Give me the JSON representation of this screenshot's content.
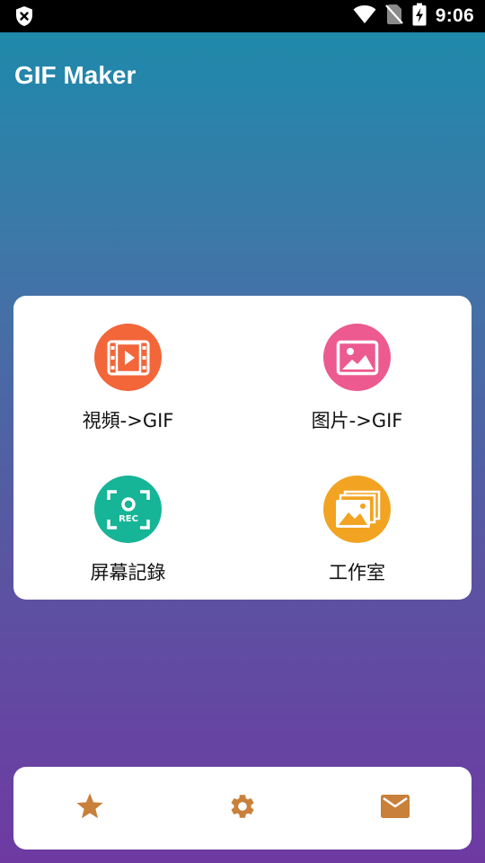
{
  "status_bar": {
    "time": "9:06",
    "icons": [
      "shield-x-icon",
      "wifi-icon",
      "no-sim-icon",
      "battery-charging-icon"
    ]
  },
  "app": {
    "title": "GIF Maker"
  },
  "menu": {
    "items": [
      {
        "label": "視頻->GIF",
        "icon": "video-film-icon",
        "color": "#f2663a"
      },
      {
        "label": "图片->GIF",
        "icon": "image-icon",
        "color": "#ec5a8f"
      },
      {
        "label": "屏幕記錄",
        "icon": "screen-record-icon",
        "color": "#16b597"
      },
      {
        "label": "工作室",
        "icon": "gallery-stack-icon",
        "color": "#f2a322"
      }
    ]
  },
  "bottom_bar": {
    "items": [
      {
        "icon": "star-icon"
      },
      {
        "icon": "gear-icon"
      },
      {
        "icon": "mail-icon"
      }
    ],
    "icon_color": "#c8803a"
  },
  "theme": {
    "gradient_top": "#1a8cab",
    "gradient_bottom": "#6e3aa2"
  }
}
